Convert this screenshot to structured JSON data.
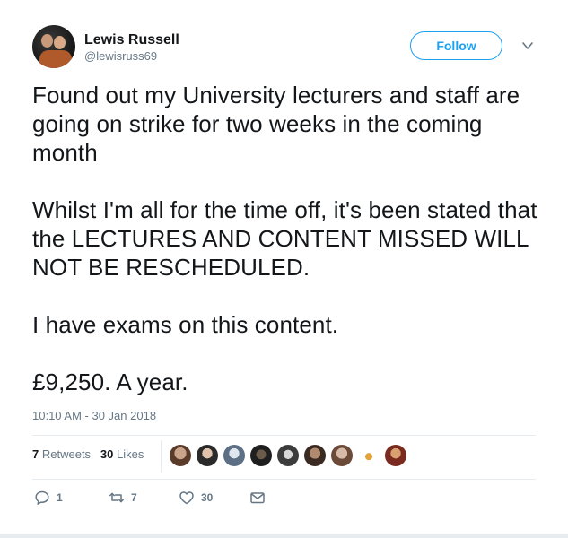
{
  "user": {
    "display_name": "Lewis Russell",
    "handle": "@lewisruss69",
    "avatar_icon": "user-avatar"
  },
  "follow_label": "Follow",
  "menu_icon": "chevron-down-icon",
  "tweet": {
    "paragraphs": [
      "Found out my University lecturers and staff are going on strike for two weeks in the coming month",
      "Whilst I'm all for the time off, it's been stated that the LECTURES AND CONTENT MISSED WILL NOT BE RESCHEDULED.",
      "I have exams on this content.",
      "£9,250. A year."
    ],
    "timestamp": "10:10 AM - 30 Jan 2018"
  },
  "stats": {
    "retweets_count": "7",
    "retweets_label": "Retweets",
    "likes_count": "30",
    "likes_label": "Likes"
  },
  "actions": {
    "reply_count": "1",
    "retweet_count": "7",
    "like_count": "30"
  },
  "colors": {
    "accent": "#1da1f2",
    "text": "#14171a",
    "muted": "#657786",
    "border": "#e6ecf0"
  }
}
